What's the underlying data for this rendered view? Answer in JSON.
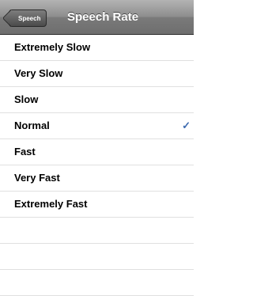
{
  "navbar": {
    "back_label": "Speech",
    "title": "Speech Rate"
  },
  "options": [
    {
      "label": "Extremely Slow",
      "selected": false
    },
    {
      "label": "Very Slow",
      "selected": false
    },
    {
      "label": "Slow",
      "selected": false
    },
    {
      "label": "Normal",
      "selected": true
    },
    {
      "label": "Fast",
      "selected": false
    },
    {
      "label": "Very Fast",
      "selected": false
    },
    {
      "label": "Extremely Fast",
      "selected": false
    }
  ],
  "checkmark": "✓",
  "colors": {
    "checkmark": "#3e6bb0",
    "navbar_top": "#b3b3b3",
    "navbar_bottom": "#6e6e6e"
  }
}
